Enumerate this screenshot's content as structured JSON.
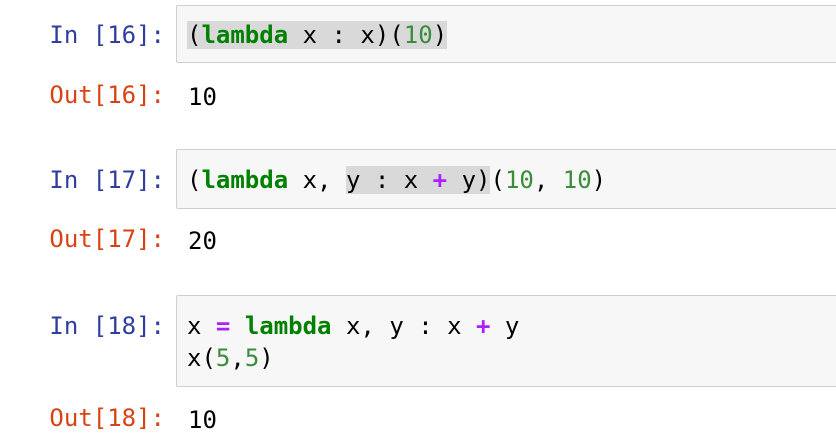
{
  "cells": [
    {
      "in_prompt": "In [16]:",
      "out_prompt": "Out[16]:",
      "code": {
        "open_paren": "(",
        "kw_lambda": "lambda",
        "sp1": " x ",
        "colon": ":",
        "sp2": " x",
        "close_paren": ")",
        "call_open": "(",
        "arg": "10",
        "call_close": ")"
      },
      "output": "10"
    },
    {
      "in_prompt": "In [17]:",
      "out_prompt": "Out[17]:",
      "code": {
        "open_paren": "(",
        "kw_lambda": "lambda",
        "params_pre": " x, ",
        "param_y": "y",
        "colon": " : ",
        "x": "x ",
        "plus": "+",
        "y_body": " y",
        "close_paren": ")",
        "call_open": "(",
        "arg1": "10",
        "comma": ", ",
        "arg2": "10",
        "call_close": ")"
      },
      "output": "20"
    },
    {
      "in_prompt": "In [18]:",
      "out_prompt": "Out[18]:",
      "code": {
        "line1_var": "x ",
        "line1_eq": "=",
        "line1_sp": " ",
        "line1_kw": "lambda",
        "line1_params": " x, y : x ",
        "line1_plus": "+",
        "line1_tail": " y",
        "line2_call": "x(",
        "line2_a": "5",
        "line2_comma": ",",
        "line2_b": "5",
        "line2_close": ")"
      },
      "output": "10"
    }
  ],
  "colors": {
    "in_prompt": "#303f9f",
    "out_prompt": "#d84315",
    "keyword": "#008000",
    "number": "#3b8c3b",
    "operator": "#aa22ff",
    "cell_background": "#f7f7f7",
    "cell_border": "#cfcfcf",
    "highlight": "#d9d9d9"
  }
}
